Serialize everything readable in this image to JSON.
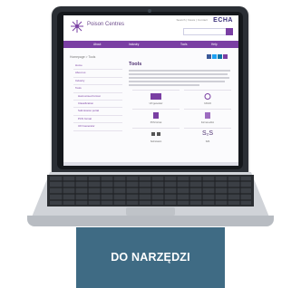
{
  "colors": {
    "primary": "#7a3fa3",
    "cta_background": "#3f6b84",
    "cta_text": "#ffffff"
  },
  "site": {
    "title": "Poison Centres",
    "brand": "ECHA",
    "utility_links": "Search | News | Contact",
    "nav": [
      "About",
      "Industry",
      "Tools",
      "Help"
    ]
  },
  "breadcrumb": "Homepage > Tools",
  "sidebar": [
    "Home",
    "About us",
    "Industry",
    "Tools",
    "Harmonised format",
    "Classification",
    "Submission portal",
    "PCN format",
    "UFI Generator"
  ],
  "content": {
    "heading": "Tools",
    "tiles": [
      "UFI generator",
      "IUCLID",
      "PCN format",
      "Format editor",
      "Submission",
      "S2S"
    ],
    "s2s": "S₂S"
  },
  "cta": {
    "label": "DO NARZĘDZI"
  }
}
